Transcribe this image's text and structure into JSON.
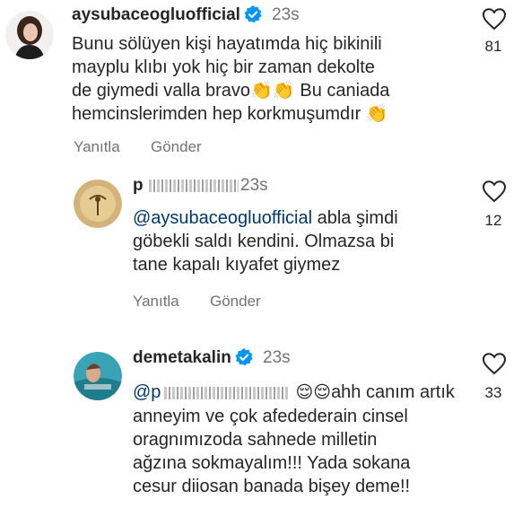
{
  "comments": [
    {
      "username": "aysubaceogluofficial",
      "verified": true,
      "time": "23s",
      "text": "Bunu sölüyen kişi hayatımda hiç bikinili\nmayplu klıbı yok hiç bir zaman dekolte\nde giymedi valla  bravo👏👏 Bu caniada\nhemcinslerimden hep korkmuşumdır 👏",
      "reply_label": "Yanıtla",
      "send_label": "Gönder",
      "likes": "81"
    },
    {
      "username_visible": "p",
      "time": "23s",
      "mention": "@aysubaceogluofficial",
      "text": " abla şimdi\ngöbekli saldı kendini. Olmazsa bi\ntane kapalı kıyafet giymez",
      "reply_label": "Yanıtla",
      "send_label": "Gönder",
      "likes": "12"
    },
    {
      "username": "demetakalin",
      "verified": true,
      "time": "23s",
      "mention_visible": "@p",
      "emoji": "😌😌",
      "text_first": "ahh canım artık",
      "text": "anneyim ve çok afedederain cinsel\noragnımızoda sahnede milletin\nağzına sokmayalım!!! Yada sokana\ncesur diiosan banada bişey deme!!",
      "likes": "33"
    }
  ],
  "colors": {
    "verified": "#0095f6",
    "muted": "#737373",
    "mention": "#00376b"
  }
}
